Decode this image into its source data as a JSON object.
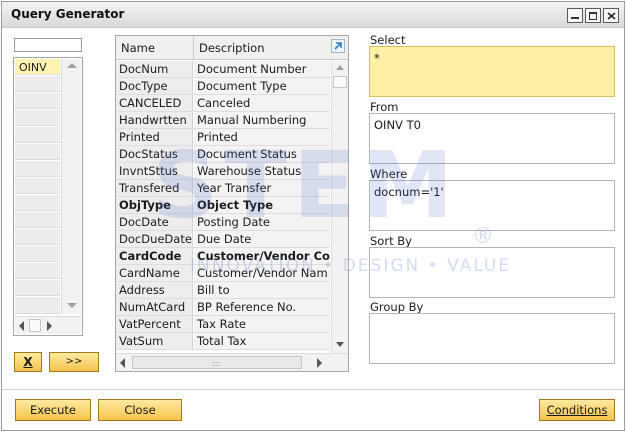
{
  "window": {
    "title": "Query Generator"
  },
  "tables": {
    "search_value": "",
    "items": [
      {
        "label": "OINV"
      }
    ]
  },
  "fields_grid": {
    "col_name": "Name",
    "col_description": "Description",
    "rows": [
      {
        "name": "DocNum",
        "description": "Document Number",
        "bold": false
      },
      {
        "name": "DocType",
        "description": "Document Type",
        "bold": false
      },
      {
        "name": "CANCELED",
        "description": "Canceled",
        "bold": false
      },
      {
        "name": "Handwrtten",
        "description": "Manual Numbering",
        "bold": false
      },
      {
        "name": "Printed",
        "description": "Printed",
        "bold": false
      },
      {
        "name": "DocStatus",
        "description": "Document Status",
        "bold": false
      },
      {
        "name": "InvntSttus",
        "description": "Warehouse Status",
        "bold": false
      },
      {
        "name": "Transfered",
        "description": "Year Transfer",
        "bold": false
      },
      {
        "name": "ObjType",
        "description": "Object Type",
        "bold": true
      },
      {
        "name": "DocDate",
        "description": "Posting Date",
        "bold": false
      },
      {
        "name": "DocDueDate",
        "description": "Due Date",
        "bold": false
      },
      {
        "name": "CardCode",
        "description": "Customer/Vendor Code",
        "bold": true
      },
      {
        "name": "CardName",
        "description": "Customer/Vendor Nam",
        "bold": false
      },
      {
        "name": "Address",
        "description": "Bill to",
        "bold": false
      },
      {
        "name": "NumAtCard",
        "description": "BP Reference No.",
        "bold": false
      },
      {
        "name": "VatPercent",
        "description": "Tax Rate",
        "bold": false
      },
      {
        "name": "VatSum",
        "description": "Total Tax",
        "bold": false
      }
    ]
  },
  "actions": {
    "remove_label": "X",
    "add_label": ">>"
  },
  "query": {
    "select_label": "Select",
    "select_value": "*",
    "from_label": "From",
    "from_value": "OINV T0",
    "where_label": "Where",
    "where_value": "docnum='1'",
    "sortby_label": "Sort By",
    "sortby_value": "",
    "groupby_label": "Group By",
    "groupby_value": ""
  },
  "footer": {
    "execute_label": "Execute",
    "close_label": "Close",
    "conditions_label": "Conditions"
  },
  "watermark": {
    "text": "STEM",
    "registered": "®",
    "tagline": "INNOVATION • DESIGN • VALUE"
  },
  "colors": {
    "button_fill": "#f4c34c",
    "select_fill": "#fff0a6",
    "selected_row": "#fff2b3"
  },
  "icons": [
    "minimize-icon",
    "maximize-icon",
    "close-icon",
    "expand-arrow-icon",
    "scroll-up-icon",
    "scroll-down-icon",
    "scroll-left-icon",
    "scroll-right-icon"
  ]
}
